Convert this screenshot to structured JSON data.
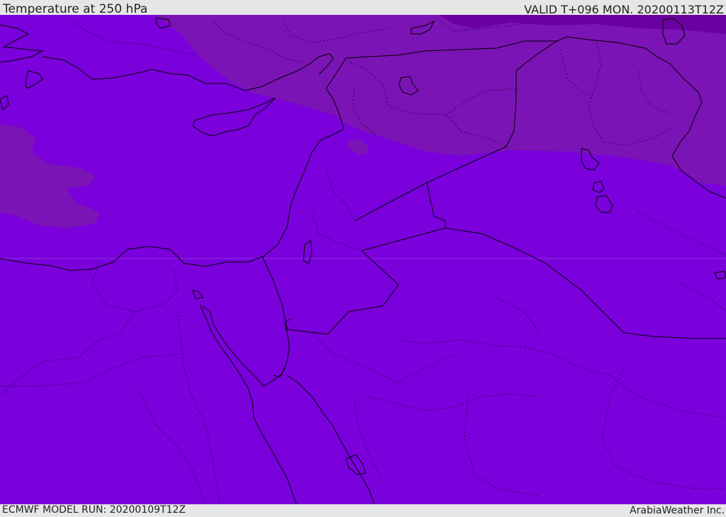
{
  "header": {
    "title": "Temperature at 250 hPa",
    "valid": "VALID T+096 MON. 20200113T12Z"
  },
  "footer": {
    "model_run": "ECMWF MODEL RUN: 20200109T12Z",
    "brand": "ArabiaWeather Inc."
  },
  "colors": {
    "base_field": "#7a00dc",
    "cooler_band": "#7b14b4",
    "coldest_band": "#6a00a0",
    "coastline": "#000000",
    "frame": "#e6e6e6"
  }
}
